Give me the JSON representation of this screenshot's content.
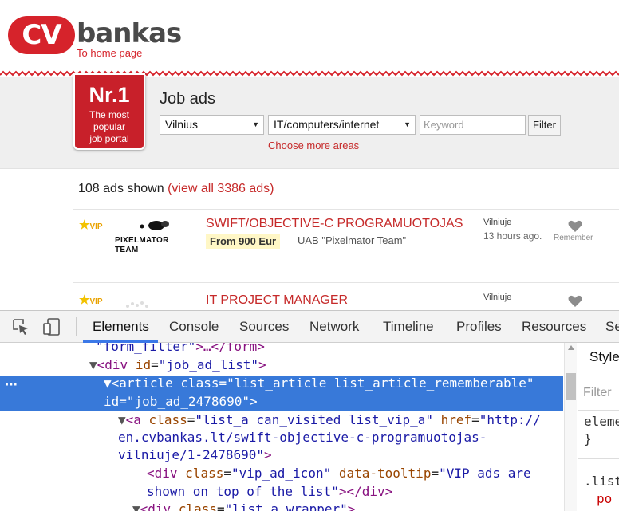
{
  "site": {
    "logo_badge": "CV",
    "logo_text": "bankas",
    "home_link": "To home page"
  },
  "search": {
    "badge_big": "Nr.1",
    "badge_line1": "The most",
    "badge_line2": "popular",
    "badge_line3": "job portal",
    "title": "Job ads",
    "city_value": "Vilnius",
    "category_value": "IT/computers/internet",
    "keyword_placeholder": "Keyword",
    "filter_label": "Filter",
    "more_areas": "Choose more areas"
  },
  "results": {
    "count_text": "108 ads shown",
    "view_all": "(view all 3386 ads)",
    "ads": [
      {
        "vip": "VIP",
        "logo_name": "PIXELMATOR TEAM",
        "title": "SWIFT/OBJECTIVE-C PROGRAMUOTOJAS",
        "salary": "From 900 Eur",
        "company": "UAB \"Pixelmator Team\"",
        "city": "Vilniuje",
        "time": "13 hours ago.",
        "remember": "Remember"
      },
      {
        "vip": "VIP",
        "title": "IT PROJECT MANAGER",
        "city": "Vilniuje"
      }
    ]
  },
  "devtools": {
    "tabs": [
      "Elements",
      "Console",
      "Sources",
      "Network",
      "Timeline",
      "Profiles",
      "Resources",
      "Se"
    ],
    "active_tab": "Elements",
    "code": {
      "l0_a": "\"form_filter\"",
      "l0_b": ">…</",
      "l0_c": "form",
      "l0_d": ">",
      "l1_tri": "▼",
      "l1_open": "<",
      "l1_tag": "div",
      "l1_attr": " id",
      "l1_eq": "=",
      "l1_val": "\"job_ad_list\"",
      "l1_close": ">",
      "l2_dots": "···",
      "l2_tri": "▼",
      "l2_open": "<",
      "l2_tag": "article",
      "l2_attr1": " class",
      "l2_eq1": "=",
      "l2_val1": "\"list_article list_article_rememberable\"",
      "l2b_attr2": "id",
      "l2b_eq2": "=",
      "l2b_val2": "\"job_ad_2478690\"",
      "l2b_close": ">",
      "l3_tri": "▼",
      "l3_open": "<",
      "l3_tag": "a",
      "l3_attr1": " class",
      "l3_eq1": "=",
      "l3_val1": "\"list_a can_visited list_vip_a\"",
      "l3_attr2": " href",
      "l3_eq2": "=",
      "l3_val2a": "\"http://",
      "l3_val2b": "en.cvbankas.lt/swift-objective-c-programuotojas-",
      "l3_val2c": "vilniuje/1-2478690\"",
      "l3_close": ">",
      "l4_open": "<",
      "l4_tag": "div",
      "l4_attr1": " class",
      "l4_eq1": "=",
      "l4_val1": "\"vip_ad_icon\"",
      "l4_attr2": " data-tooltip",
      "l4_eq2": "=",
      "l4_val2a": "\"VIP ads are",
      "l4_val2b": "shown on top of the list\"",
      "l4_end": "></",
      "l4_tag2": "div",
      "l4_close": ">",
      "l5_tri": "▼",
      "l5_open": "<",
      "l5_tag": "div",
      "l5_attr": " class",
      "l5_eq": "=",
      "l5_val": "\"list_a_wrapper\"",
      "l5_close": ">"
    },
    "side": {
      "tab": "Styles",
      "filter": "Filter",
      "line1": "element",
      "line2": "}",
      "line3": ".list",
      "line4": "po"
    }
  },
  "colors": {
    "brand_red": "#d6232b",
    "link_red": "#c62a2a",
    "selection_blue": "#3879d9",
    "tag_purple": "#881280",
    "attr_brown": "#994500",
    "value_blue": "#1a1aa6"
  }
}
